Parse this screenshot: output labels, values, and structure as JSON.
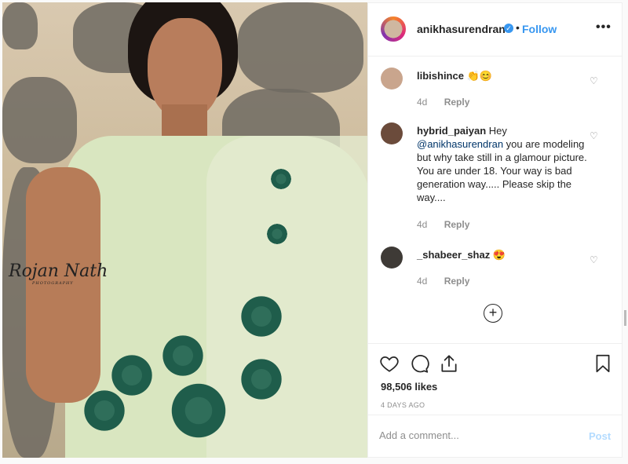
{
  "post": {
    "image": {
      "watermark_line1": "Rojan Nath",
      "watermark_line2": "PHOTOGRAPHY"
    },
    "header": {
      "username": "anikhasurendran",
      "verified_icon": "verified-badge-icon",
      "dot": "•",
      "follow_label": "Follow",
      "more_icon": "•••"
    },
    "comments": [
      {
        "user": "libishince",
        "text": "👏😊",
        "mention": "",
        "after": "",
        "time": "4d",
        "reply": "Reply"
      },
      {
        "user": "hybrid_paiyan",
        "text": "Hey",
        "mention": "@anikhasurendran",
        "after": "you are modeling but why take still in a glamour picture. You are under 18. Your way is bad generation way..... Please skip the way....",
        "time": "4d",
        "reply": "Reply"
      },
      {
        "user": "_shabeer_shaz",
        "text": "😍",
        "mention": "",
        "after": "",
        "time": "4d",
        "reply": "Reply"
      }
    ],
    "load_more_icon": "+",
    "likes": "98,506 likes",
    "timestamp": "4 DAYS AGO",
    "add_comment_placeholder": "Add a comment...",
    "post_label": "Post",
    "colors": {
      "accent": "#3897f0",
      "post_disabled": "#b3dbff",
      "muted": "#8e8e8e"
    }
  }
}
